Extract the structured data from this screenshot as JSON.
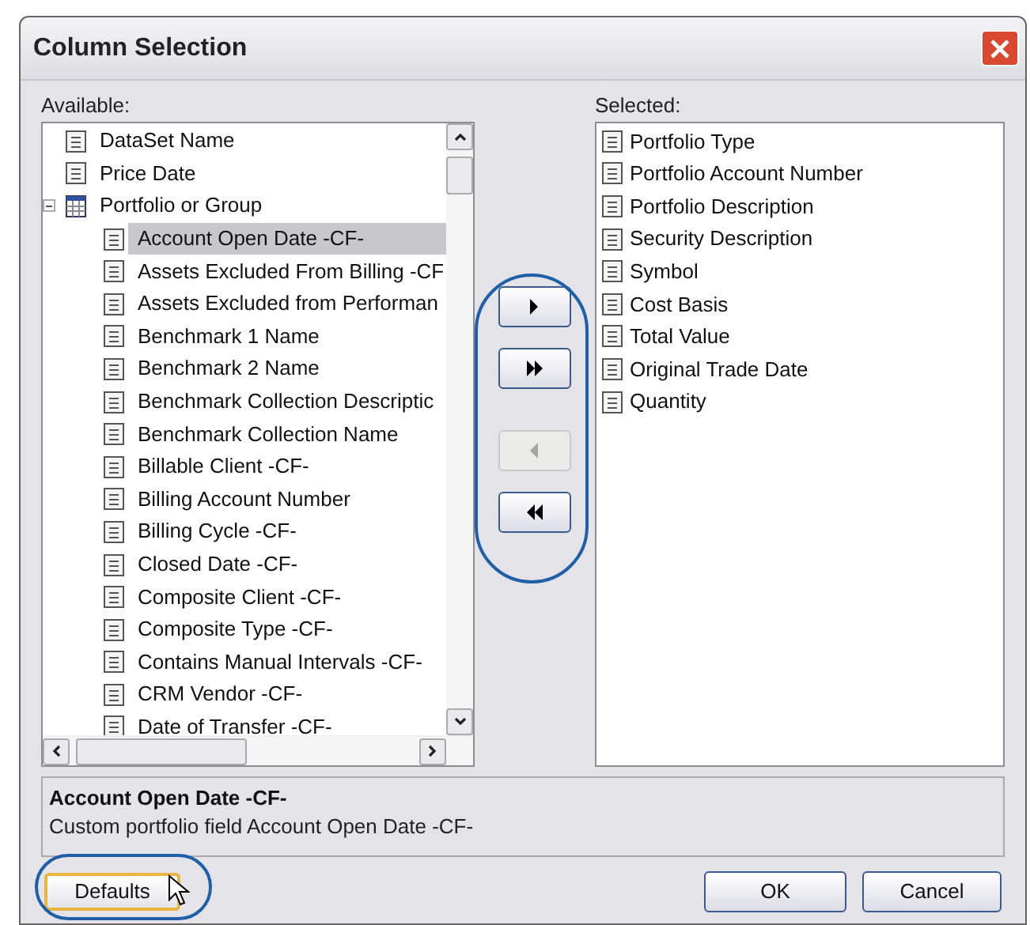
{
  "window": {
    "title": "Column Selection"
  },
  "available": {
    "label": "Available:",
    "items": [
      {
        "label": "DataSet Name",
        "kind": "field",
        "selected": false
      },
      {
        "label": "Price Date",
        "kind": "field",
        "selected": false
      },
      {
        "label": "Portfolio or Group",
        "kind": "table",
        "selected": false,
        "expanded": true,
        "children": [
          {
            "label": "Account Open Date -CF-",
            "kind": "field",
            "selected": true
          },
          {
            "label": "Assets Excluded From Billing -CF",
            "kind": "field",
            "selected": false
          },
          {
            "label": "Assets Excluded from Performan",
            "kind": "field",
            "selected": false
          },
          {
            "label": "Benchmark 1 Name",
            "kind": "field",
            "selected": false
          },
          {
            "label": "Benchmark 2 Name",
            "kind": "field",
            "selected": false
          },
          {
            "label": "Benchmark Collection Descriptic",
            "kind": "field",
            "selected": false
          },
          {
            "label": "Benchmark Collection Name",
            "kind": "field",
            "selected": false
          },
          {
            "label": "Billable Client -CF-",
            "kind": "field",
            "selected": false
          },
          {
            "label": "Billing Account Number",
            "kind": "field",
            "selected": false
          },
          {
            "label": "Billing Cycle -CF-",
            "kind": "field",
            "selected": false
          },
          {
            "label": "Closed Date -CF-",
            "kind": "field",
            "selected": false
          },
          {
            "label": "Composite Client -CF-",
            "kind": "field",
            "selected": false
          },
          {
            "label": "Composite Type -CF-",
            "kind": "field",
            "selected": false
          },
          {
            "label": "Contains Manual Intervals -CF-",
            "kind": "field",
            "selected": false
          },
          {
            "label": "CRM Vendor -CF-",
            "kind": "field",
            "selected": false
          },
          {
            "label": "Date of Transfer -CF-",
            "kind": "field",
            "selected": false
          }
        ]
      }
    ]
  },
  "transfer_buttons": [
    {
      "kind": "add",
      "disabled": false
    },
    {
      "kind": "add_all",
      "disabled": false
    },
    {
      "kind": "remove",
      "disabled": true
    },
    {
      "kind": "remove_all",
      "disabled": false
    }
  ],
  "selected": {
    "label": "Selected:",
    "items": [
      {
        "label": "Portfolio Type"
      },
      {
        "label": "Portfolio Account Number"
      },
      {
        "label": "Portfolio Description"
      },
      {
        "label": "Security Description"
      },
      {
        "label": "Symbol"
      },
      {
        "label": "Cost Basis"
      },
      {
        "label": "Total Value"
      },
      {
        "label": "Original Trade Date"
      },
      {
        "label": "Quantity"
      }
    ]
  },
  "description": {
    "title": "Account Open Date -CF-",
    "text": "Custom portfolio field Account Open Date -CF-"
  },
  "buttons": {
    "defaults": "Defaults",
    "ok": "OK",
    "cancel": "Cancel"
  }
}
